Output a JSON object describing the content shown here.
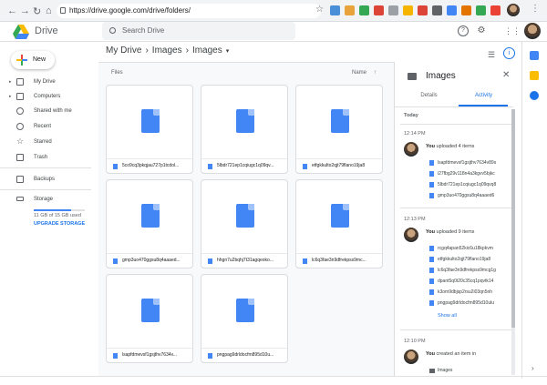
{
  "browser": {
    "url": "https://drive.google.com/drive/folders/",
    "back_icon": "arrow-left-icon",
    "forward_icon": "arrow-right-icon",
    "reload_icon": "reload-icon",
    "home_icon": "home-icon"
  },
  "header": {
    "app_title": "Drive",
    "search_placeholder": "Search Drive",
    "help_icon": "help-icon",
    "settings_icon": "gear-icon",
    "apps_icon": "apps-grid-icon"
  },
  "sidebar": {
    "new_label": "New",
    "items": [
      {
        "label": "My Drive",
        "icon": "drive-icon",
        "arrow": "▸"
      },
      {
        "label": "Computers",
        "icon": "computer-icon",
        "arrow": "▸"
      },
      {
        "label": "Shared with me",
        "icon": "people-icon",
        "arrow": ""
      },
      {
        "label": "Recent",
        "icon": "clock-icon",
        "arrow": ""
      },
      {
        "label": "Starred",
        "icon": "star-icon",
        "arrow": ""
      },
      {
        "label": "Trash",
        "icon": "trash-icon",
        "arrow": ""
      },
      {
        "label": "Backups",
        "icon": "backup-icon",
        "arrow": ""
      },
      {
        "label": "Storage",
        "icon": "storage-icon",
        "arrow": ""
      }
    ],
    "storage_used": "11 GB of 15 GB used",
    "storage_fraction": 0.73,
    "upgrade_label": "UPGRADE STORAGE"
  },
  "breadcrumb": {
    "root": "My Drive",
    "sep1": "›",
    "mid": "Images",
    "sep2": "›",
    "current": "Images",
    "dropdown": "▾"
  },
  "files": {
    "section_label": "Files",
    "sort_label": "Name",
    "sort_arrow": "↑",
    "items": [
      "5co9cq3pkqjau727p1tcdol...",
      "5lbdr721ep1cqiugc1q09qv...",
      "etfgkkulto2qjt79flano19ja8",
      "gmp3uo470ggsu8q4aaaed...",
      "hhgn7u2bqhj7t31agqeoko...",
      "lc6q3fae3n9dfrekpss9mc...",
      "lsapfdmevsf1gsjthv7634v...",
      "pngpag9drldocfm895d10u..."
    ]
  },
  "panel": {
    "title": "Images",
    "close": "✕",
    "tab_details": "Details",
    "tab_activity": "Activity",
    "today": "Today",
    "activities": [
      {
        "time": "12:14 PM",
        "user": "You",
        "action": "uploaded 4 items",
        "items": [
          "lsapfdmevsf1gsjthv7634v89s",
          "i27fbg29v118n4a3kgvv5bjkc",
          "5lbdr721ep1cqiugc1q09qvq8",
          "gmp3uo470ggsu8q4aaaed6"
        ]
      },
      {
        "time": "12:13 PM",
        "user": "You",
        "action": "uploaded 9 items",
        "items": [
          "rcgq4apan52kic6u18kpkvm",
          "etfgkkulto2qjt79flano19ja8",
          "lc6q3fae3n9dfrekpss9mcg1g",
          "dpant5q0t20c35cq1pqvtk14",
          "k3om9dbjsp2rsu2i03qn5nh",
          "pngpag9drldocfm895d10ulu"
        ],
        "show_all": "Show all"
      },
      {
        "time": "12:10 PM",
        "user": "You",
        "action": "created an item in",
        "items": [
          "Images"
        ]
      }
    ]
  },
  "colors": {
    "accent": "#1a73e8",
    "doc_blue": "#4285f4"
  }
}
